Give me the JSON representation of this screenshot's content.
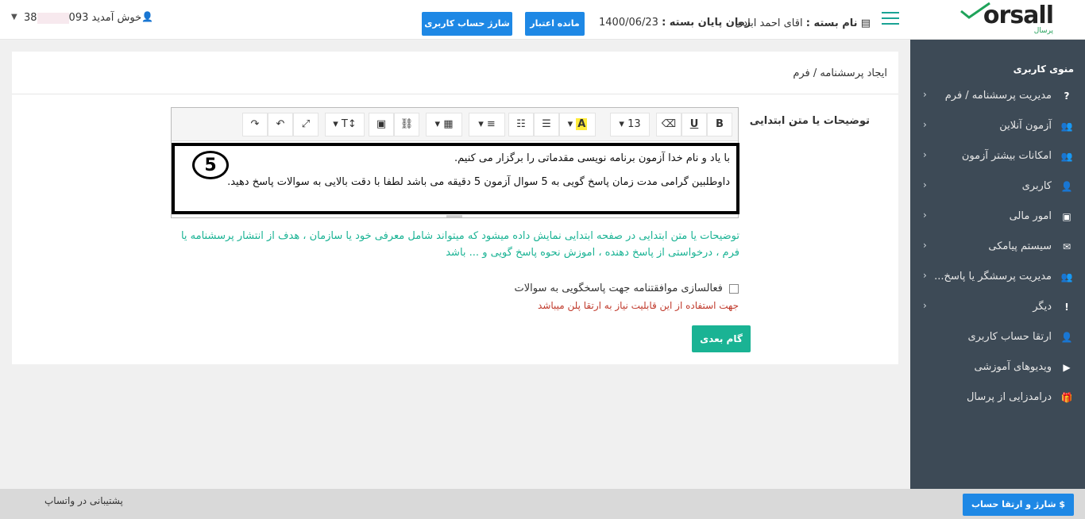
{
  "header": {
    "package_label": "نام بسته :",
    "package_value": "اقای احمد ابادی",
    "end_label": "زمان پایان بسته :",
    "end_value": "1400/06/23",
    "balance_button": "مانده اعتبار",
    "charge_button": "شارژ حساب کاربری",
    "user_phone_start": "093",
    "user_phone_end": "38",
    "welcome": "خوش آمدید"
  },
  "logo": {
    "word": "orsall",
    "tagline": "پرسال"
  },
  "sidebar": {
    "title": "منوی کاربری",
    "items": [
      {
        "label": "مدیریت پرسشنامه / فرم",
        "icon": "question-icon",
        "glyph": "?",
        "chevron": "‹"
      },
      {
        "label": "آزمون آنلاین",
        "icon": "users-icon",
        "glyph": "👥",
        "chevron": "‹"
      },
      {
        "label": "امکانات بیشتر آزمون",
        "icon": "users-icon",
        "glyph": "👥",
        "chevron": "‹"
      },
      {
        "label": "کاربری",
        "icon": "user-icon",
        "glyph": "👤",
        "chevron": "‹"
      },
      {
        "label": "امور مالی",
        "icon": "money-icon",
        "glyph": "▣",
        "chevron": "‹"
      },
      {
        "label": "سیستم پیامکی",
        "icon": "envelope-icon",
        "glyph": "✉",
        "chevron": "‹"
      },
      {
        "label": "مدیریت پرسشگر یا پاسخ...",
        "icon": "users-icon",
        "glyph": "👥",
        "chevron": "‹"
      },
      {
        "label": "دیگر",
        "icon": "exclamation-icon",
        "glyph": "!",
        "chevron": "‹"
      },
      {
        "label": "ارتقا حساب کاربری",
        "icon": "user-icon",
        "glyph": "👤",
        "chevron": ""
      },
      {
        "label": "ویدیوهای آموزشی",
        "icon": "video-icon",
        "glyph": "▶",
        "chevron": ""
      },
      {
        "label": "درامدزایی از پرسال",
        "icon": "gift-icon",
        "glyph": "🎁",
        "chevron": ""
      }
    ]
  },
  "main": {
    "breadcrumb": "ایجاد پرسشنامه / فرم",
    "field_label": "توضیحات یا متن ابتدایی",
    "editor": {
      "line1": "با یاد و نام خدا آزمون برنامه نویسی مقدماتی  را برگزار می کنیم.",
      "line2": "داوطلبین گرامی مدت زمان پاسخ گویی به 5 سوال  آزمون 5 دقیقه می باشد لطفا با دقت بالایی به سوالات پاسخ دهید.",
      "badge": "5",
      "font_size": "13",
      "toolbar": {
        "bold": "B",
        "underline": "U",
        "eraser": "⌫",
        "size": "13",
        "color": "A",
        "ul": "☰",
        "ol": "☷",
        "align": "≡",
        "table": "▦",
        "link": "⛓",
        "image": "▣",
        "textsize": "T↕",
        "fullscreen": "⤢",
        "undo": "↶",
        "redo": "↷"
      }
    },
    "hint": "توضیحات یا متن ابتدایی در صفحه ابتدایی نمایش داده میشود که میتواند شامل معرفی خود یا سازمان ، هدف از انتشار پرسشنامه یا فرم ، درخواستی از پاسخ دهنده ، اموزش نحوه پاسخ گویی و ... باشد",
    "agreement_label": "فعالسازی موافقتنامه جهت پاسخگویی به سوالات",
    "agreement_warning": "جهت استفاده از این قابلیت نیاز به ارتقا پلن میباشد",
    "next_button": "گام بعدی"
  },
  "footer": {
    "whatsapp": "پشتیبانی در واتساپ",
    "charge_upgrade": "$ شارژ و ارتقا حساب کاربری"
  }
}
